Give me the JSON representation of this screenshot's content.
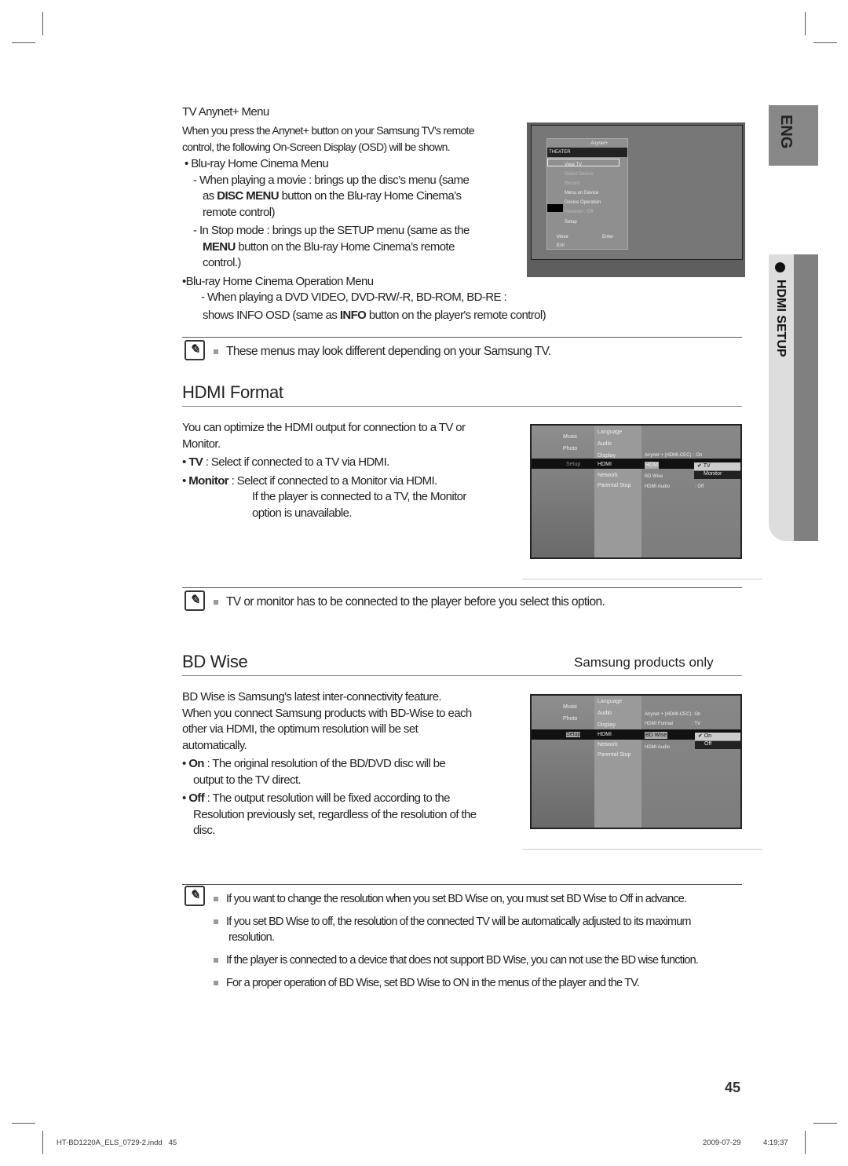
{
  "anynet": {
    "heading": "TV Anynet+ Menu",
    "intro1": "When you press the Anynet+ button on your Samsung TV's remote",
    "intro2": "control, the following On-Screen Display (OSD) will be shown.",
    "b1": "• Blu-ray Home Cinema Menu",
    "b1a_1": "- When playing a movie : brings up the disc’s menu (same",
    "b1a_2a": "as ",
    "b1a_2b": "DISC MENU",
    "b1a_2c": " button on the Blu-ray Home Cinema’s",
    "b1a_3": "remote control)",
    "b1b_1": "- In Stop mode : brings up the SETUP menu (same as the",
    "b1b_2a": "MENU",
    "b1b_2b": " button on the Blu-ray Home Cinema’s remote",
    "b1b_3": "control.)",
    "b2": "•Blu-ray Home Cinema Operation Menu",
    "b2a_1": "- When playing a DVD VIDEO, DVD-RW/-R, BD-ROM, BD-RE :",
    "b2a_2a": "shows INFO OSD (same as ",
    "b2a_2b": "INFO",
    "b2a_2c": " button on the player's remote control)",
    "note": "These menus may look different depending on your Samsung TV.",
    "osd": {
      "logo": "Anynet+",
      "title": "THEATER",
      "items": [
        "View TV",
        "Select Device",
        "Record",
        "Menu on Device",
        "Device Operation",
        "Receiver     : Off",
        "Setup"
      ],
      "move": "Move",
      "enter": "Enter",
      "exit": "Exit"
    }
  },
  "hdmi_format": {
    "title": "HDMI Format",
    "p1": "You can optimize the HDMI output for connection to a TV or",
    "p2": "Monitor.",
    "tv_label": "TV",
    "tv_text": " : Select if connected to a TV via HDMI.",
    "mon_label": "Monitor",
    "mon_text": " : Select if connected to a Monitor via HDMI.",
    "mon_sub1": "If the player is connected to a TV, the Monitor",
    "mon_sub2": "option is unavailable.",
    "note": "TV or monitor has to be connected to the player before you select this option.",
    "osd": {
      "left": [
        "Music",
        "Photo",
        "Setup"
      ],
      "mid": [
        "Language",
        "Audio",
        "Display",
        "HDMI",
        "Network",
        "Parental Stup"
      ],
      "right": [
        [
          "Anynet + (HDMI-CEC)",
          ": On"
        ],
        [
          "HDMI Format",
          ""
        ],
        [
          "BD Wise",
          ":"
        ],
        [
          "HDMI Audio",
          ": Off"
        ]
      ],
      "options": [
        "TV",
        "Monitor"
      ]
    }
  },
  "bd_wise": {
    "title": "BD Wise",
    "badge": "Samsung products only",
    "p1": "BD Wise is Samsung's latest inter-connectivity feature.",
    "p2": "When you connect Samsung products with BD-Wise to each",
    "p3": "other via HDMI, the optimum resolution will be set",
    "p4": "automatically.",
    "on_label": "On",
    "on_text": " : The original resolution of the BD/DVD disc will be",
    "on_sub": "output to the TV direct.",
    "off_label": "Off",
    "off_text": " : The output resolution will be fixed according to the",
    "off_sub1": "Resolution previously set, regardless of the resolution of the",
    "off_sub2": "disc.",
    "osd": {
      "left": [
        "Music",
        "Photo",
        "Setup"
      ],
      "mid": [
        "Language",
        "Audio",
        "Display",
        "HDMI",
        "Network",
        "Parental Stup"
      ],
      "right": [
        [
          "Anynet + (HDMI-CEC)",
          ": On"
        ],
        [
          "HDMI Format",
          ": TV"
        ],
        [
          "BD Wise",
          ""
        ],
        [
          "HDMI Audio",
          ""
        ]
      ],
      "options": [
        "On",
        "Off"
      ]
    },
    "notes": [
      "If you want to change the resolution when you set BD Wise on, you must set BD Wise to Off in advance.",
      "If you set BD Wise to off, the resolution of the connected TV will be automatically adjusted to its maximum",
      "resolution.",
      "If the player is connected to a device that does not support BD Wise, you can not use the BD wise function.",
      "For a proper operation of BD Wise, set BD Wise to ON in the menus of the player and the TV."
    ]
  },
  "side": {
    "lang": "ENG",
    "section": "HDMI SETUP"
  },
  "page_number": "45",
  "footer": {
    "file": "HT-BD1220A_ELS_0729-2.indd   45",
    "date": "2009-07-29",
    "time": "4:19:37"
  }
}
